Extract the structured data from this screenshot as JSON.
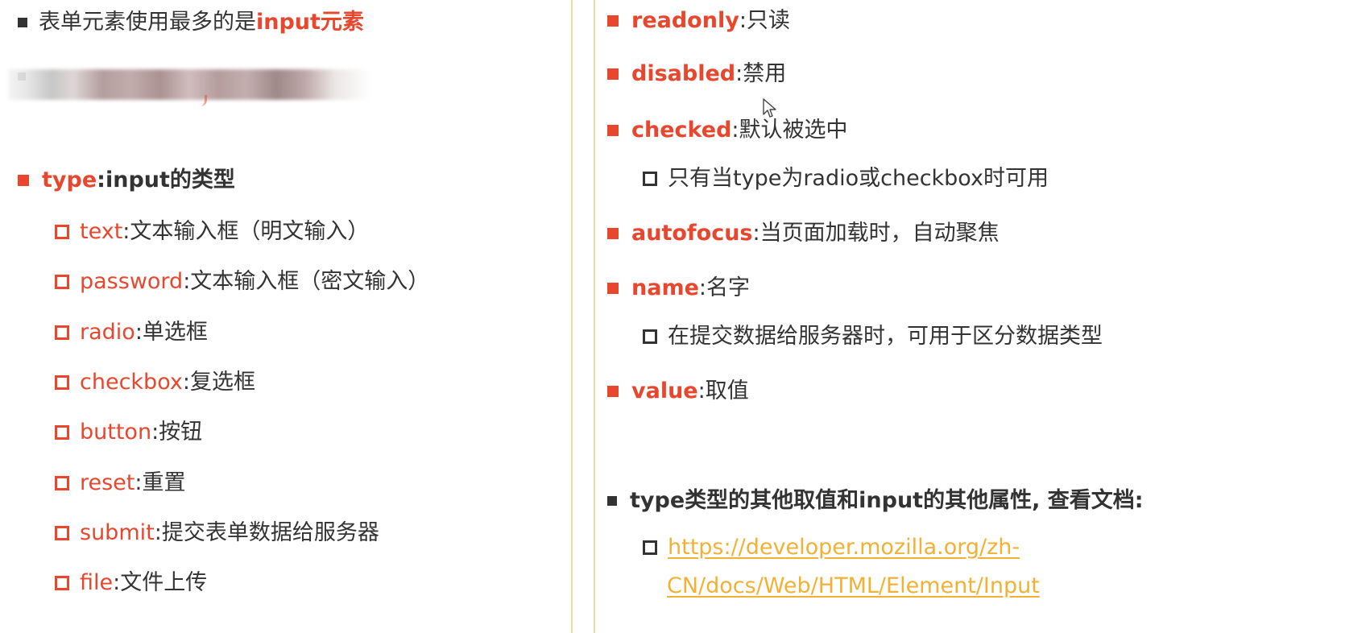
{
  "left": {
    "intro": {
      "text": "表单元素使用最多的是",
      "highlight": "input元素"
    },
    "type_heading": {
      "label": "type",
      "sep": ": ",
      "desc": "input的类型"
    },
    "types": [
      {
        "name": "text",
        "sep": ": ",
        "desc": "文本输入框（明文输入）"
      },
      {
        "name": "password",
        "sep": ": ",
        "desc": "文本输入框（密文输入）"
      },
      {
        "name": "radio",
        "sep": ": ",
        "desc": "单选框"
      },
      {
        "name": "checkbox",
        "sep": ": ",
        "desc": "复选框"
      },
      {
        "name": "button",
        "sep": ": ",
        "desc": "按钮"
      },
      {
        "name": "reset",
        "sep": ": ",
        "desc": "重置"
      },
      {
        "name": "submit",
        "sep": ": ",
        "desc": "提交表单数据给服务器"
      },
      {
        "name": "file",
        "sep": ": ",
        "desc": "文件上传"
      }
    ]
  },
  "right": {
    "attributes": [
      {
        "name": "readonly",
        "sep": ": ",
        "desc": "只读"
      },
      {
        "name": "disabled",
        "sep": ": ",
        "desc": "禁用"
      },
      {
        "name": "checked",
        "sep": ": ",
        "desc": "默认被选中"
      },
      {
        "name": "autofocus",
        "sep": ": ",
        "desc": "当页面加载时，自动聚焦"
      },
      {
        "name": "name",
        "sep": ": ",
        "desc": "名字"
      },
      {
        "name": "value",
        "sep": ": ",
        "desc": "取值"
      }
    ],
    "checked_note": "只有当type为radio或checkbox时可用",
    "name_note": "在提交数据给服务器时，可用于区分数据类型",
    "docs_heading": "type类型的其他取值和input的其他属性, 查看文档:",
    "docs_link_line1": "https://developer.mozilla.org/zh-",
    "docs_link_line2": "CN/docs/Web/HTML/Element/Input"
  },
  "colors": {
    "accent": "#e8472d",
    "text": "#333333",
    "link": "#f2b134",
    "divider": "#f0d9a8"
  },
  "icons": [
    "square-bullet-icon",
    "hollow-square-bullet-icon",
    "mouse-cursor-icon"
  ]
}
